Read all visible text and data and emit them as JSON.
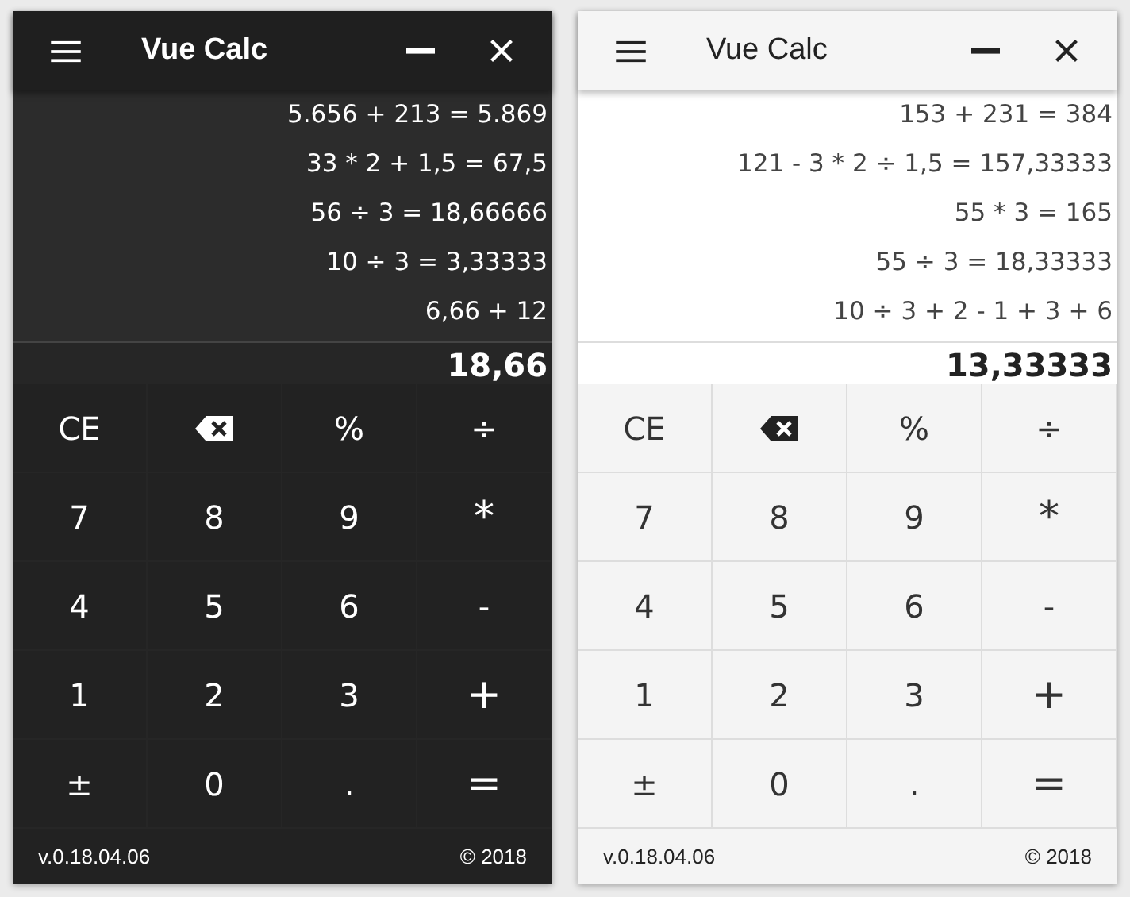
{
  "windows": [
    {
      "dark": true,
      "title": "Vue Calc",
      "history": [
        "5.656 + 213 = 5.869",
        "33 * 2 + 1,5 = 67,5",
        "56 ÷ 3 = 18,66666",
        "10 ÷ 3 = 3,33333",
        "6,66 + 12"
      ],
      "result": "18,66",
      "keys": [
        {
          "kind": "text",
          "label": "CE"
        },
        {
          "kind": "backspace"
        },
        {
          "kind": "text",
          "label": "%"
        },
        {
          "kind": "text",
          "label": "÷"
        },
        {
          "kind": "text",
          "label": "7"
        },
        {
          "kind": "text",
          "label": "8"
        },
        {
          "kind": "text",
          "label": "9"
        },
        {
          "kind": "big",
          "label": "*"
        },
        {
          "kind": "text",
          "label": "4"
        },
        {
          "kind": "text",
          "label": "5"
        },
        {
          "kind": "text",
          "label": "6"
        },
        {
          "kind": "text",
          "label": "-"
        },
        {
          "kind": "text",
          "label": "1"
        },
        {
          "kind": "text",
          "label": "2"
        },
        {
          "kind": "text",
          "label": "3"
        },
        {
          "kind": "big",
          "label": "+"
        },
        {
          "kind": "text",
          "label": "±"
        },
        {
          "kind": "text",
          "label": "0"
        },
        {
          "kind": "text",
          "label": "."
        },
        {
          "kind": "big",
          "label": "="
        }
      ],
      "version": "v.0.18.04.06",
      "copyright": "© 2018"
    },
    {
      "dark": false,
      "title": "Vue Calc",
      "history": [
        "153 + 231 = 384",
        "121 - 3 * 2 ÷ 1,5 = 157,33333",
        "55 * 3 = 165",
        "55 ÷ 3 = 18,33333",
        "10 ÷ 3 + 2 - 1 + 3 + 6"
      ],
      "result": "13,33333",
      "keys": [
        {
          "kind": "text",
          "label": "CE"
        },
        {
          "kind": "backspace"
        },
        {
          "kind": "text",
          "label": "%"
        },
        {
          "kind": "text",
          "label": "÷"
        },
        {
          "kind": "text",
          "label": "7"
        },
        {
          "kind": "text",
          "label": "8"
        },
        {
          "kind": "text",
          "label": "9"
        },
        {
          "kind": "big",
          "label": "*"
        },
        {
          "kind": "text",
          "label": "4"
        },
        {
          "kind": "text",
          "label": "5"
        },
        {
          "kind": "text",
          "label": "6"
        },
        {
          "kind": "text",
          "label": "-"
        },
        {
          "kind": "text",
          "label": "1"
        },
        {
          "kind": "text",
          "label": "2"
        },
        {
          "kind": "text",
          "label": "3"
        },
        {
          "kind": "big",
          "label": "+"
        },
        {
          "kind": "text",
          "label": "±"
        },
        {
          "kind": "text",
          "label": "0"
        },
        {
          "kind": "text",
          "label": "."
        },
        {
          "kind": "big",
          "label": "="
        }
      ],
      "version": "v.0.18.04.06",
      "copyright": "© 2018"
    }
  ]
}
